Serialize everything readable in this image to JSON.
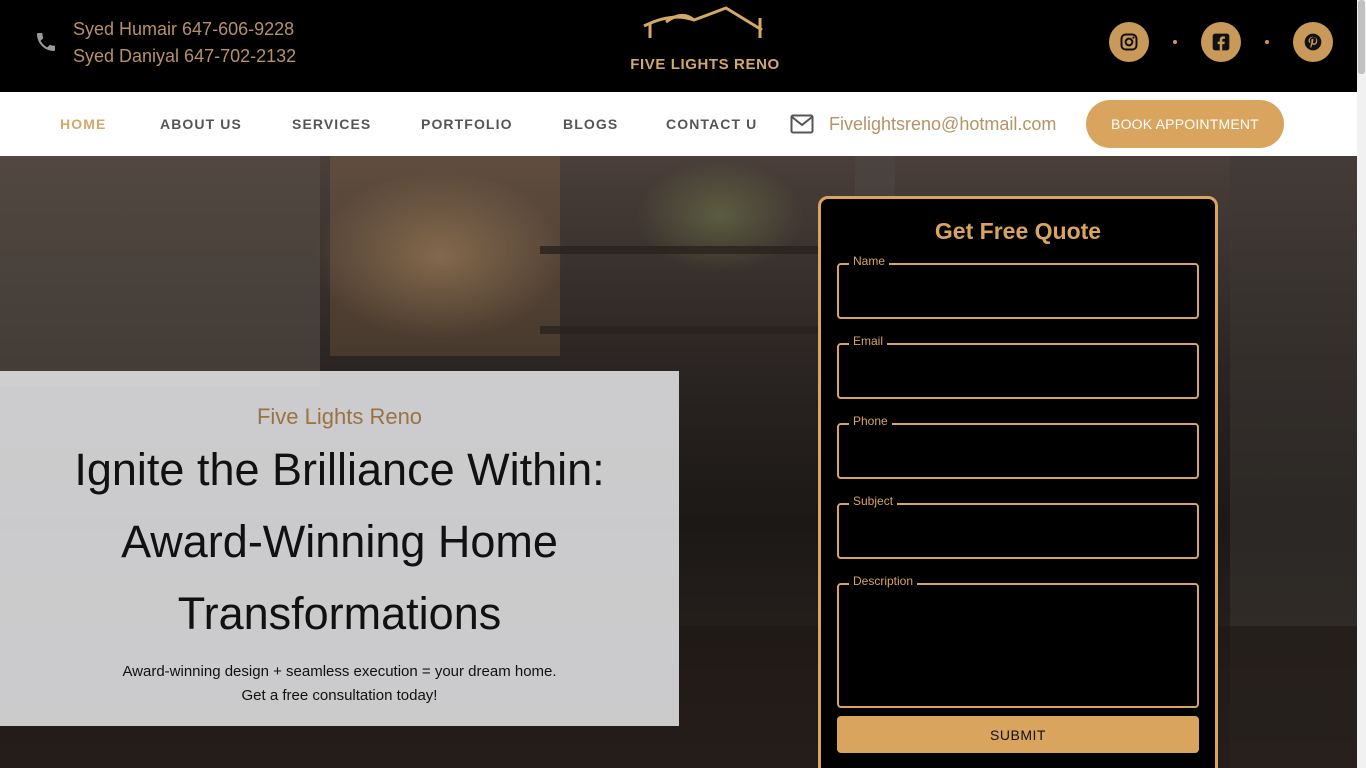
{
  "header": {
    "contacts": [
      "Syed Humair 647-606-9228",
      "Syed Daniyal 647-702-2132"
    ],
    "brand": "FIVE LIGHTS RENO",
    "social": [
      "instagram-icon",
      "facebook-icon",
      "pinterest-icon"
    ]
  },
  "nav": {
    "items": [
      "HOME",
      "ABOUT US",
      "SERVICES",
      "PORTFOLIO",
      "BLOGS",
      "CONTACT US"
    ],
    "active": "HOME",
    "email": "Fivelightsreno@hotmail.com",
    "book_label": "BOOK APPOINTMENT"
  },
  "hero": {
    "kicker": "Five Lights Reno",
    "title_lines": [
      "Ignite the Brilliance Within:",
      "Award-Winning Home",
      "Transformations"
    ],
    "sub_lines": [
      "Award-winning design + seamless execution = your dream home.",
      "Get a free consultation today!"
    ]
  },
  "quote_form": {
    "title": "Get Free Quote",
    "fields": [
      "Name",
      "Email",
      "Phone",
      "Subject",
      "Description"
    ],
    "submit_label": "SUBMIT"
  },
  "colors": {
    "accent": "#d9a55e",
    "accent_text": "#b79266",
    "background": "#000000"
  }
}
